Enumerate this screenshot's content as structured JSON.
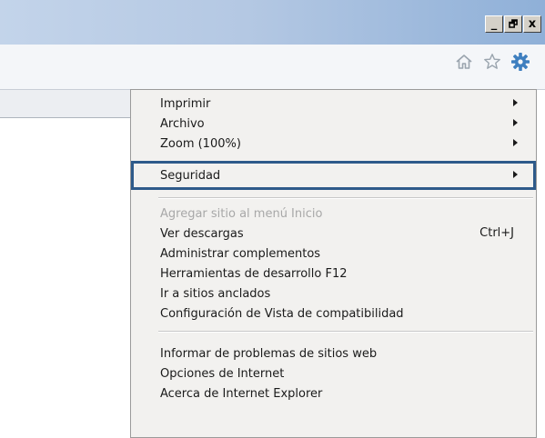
{
  "window": {
    "controls": {
      "minimize": "_",
      "maximize": "🗗",
      "close": "x"
    }
  },
  "toolbar": {
    "icons": [
      "home-icon",
      "favorites-star-icon",
      "tools-gear-icon"
    ]
  },
  "menu": {
    "group1": [
      {
        "label": "Imprimir",
        "submenu": true
      },
      {
        "label": "Archivo",
        "submenu": true
      },
      {
        "label": "Zoom (100%)",
        "submenu": true
      },
      {
        "label": "Seguridad",
        "submenu": true,
        "highlighted": true
      }
    ],
    "group2": [
      {
        "label": "Agregar sitio al menú Inicio",
        "disabled": true
      },
      {
        "label": "Ver descargas",
        "shortcut": "Ctrl+J"
      },
      {
        "label": "Administrar complementos"
      },
      {
        "label": "Herramientas de desarrollo F12"
      },
      {
        "label": "Ir a sitios anclados"
      },
      {
        "label": "Configuración de Vista de compatibilidad"
      }
    ],
    "group3": [
      {
        "label": "Informar de problemas de sitios web"
      },
      {
        "label": "Opciones de Internet"
      },
      {
        "label": "Acerca de Internet Explorer"
      }
    ]
  },
  "colors": {
    "highlight_border": "#2e5a8a",
    "gear": "#3e7fbf",
    "menu_bg": "#f2f1ef"
  }
}
